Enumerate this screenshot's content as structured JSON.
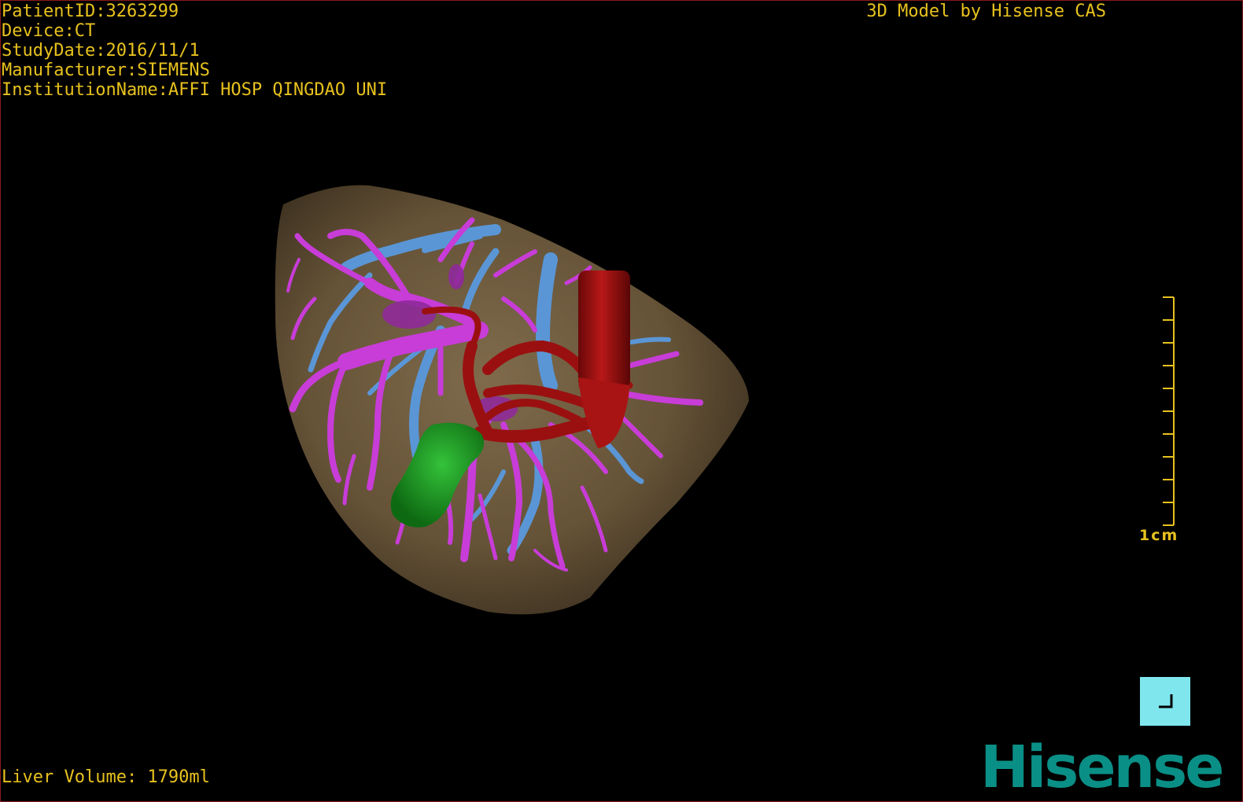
{
  "patient_info": {
    "patient_id": "PatientID:3263299",
    "device": "Device:CT",
    "study_date": "StudyDate:2016/11/1",
    "manufacturer": "Manufacturer:SIEMENS",
    "institution": "InstitutionName:AFFI HOSP QINGDAO UNI"
  },
  "credit": "3D Model by Hisense CAS",
  "liver_volume": "Liver Volume: 1790ml",
  "scale_bar": {
    "label": "1cm",
    "tick_count": 10
  },
  "logo": {
    "text": "Hisense",
    "color": "#0a8f86"
  },
  "colors": {
    "overlay_text": "#e8c21e",
    "liver": "#7a6545",
    "portal_vein": "#c83cd8",
    "hepatic_vein": "#5a96d6",
    "artery": "#9a1010",
    "gallbladder": "#1e9a24",
    "reset_button": "#7fe6ee"
  },
  "icons": {
    "reset_view": "corner-bracket-icon"
  }
}
